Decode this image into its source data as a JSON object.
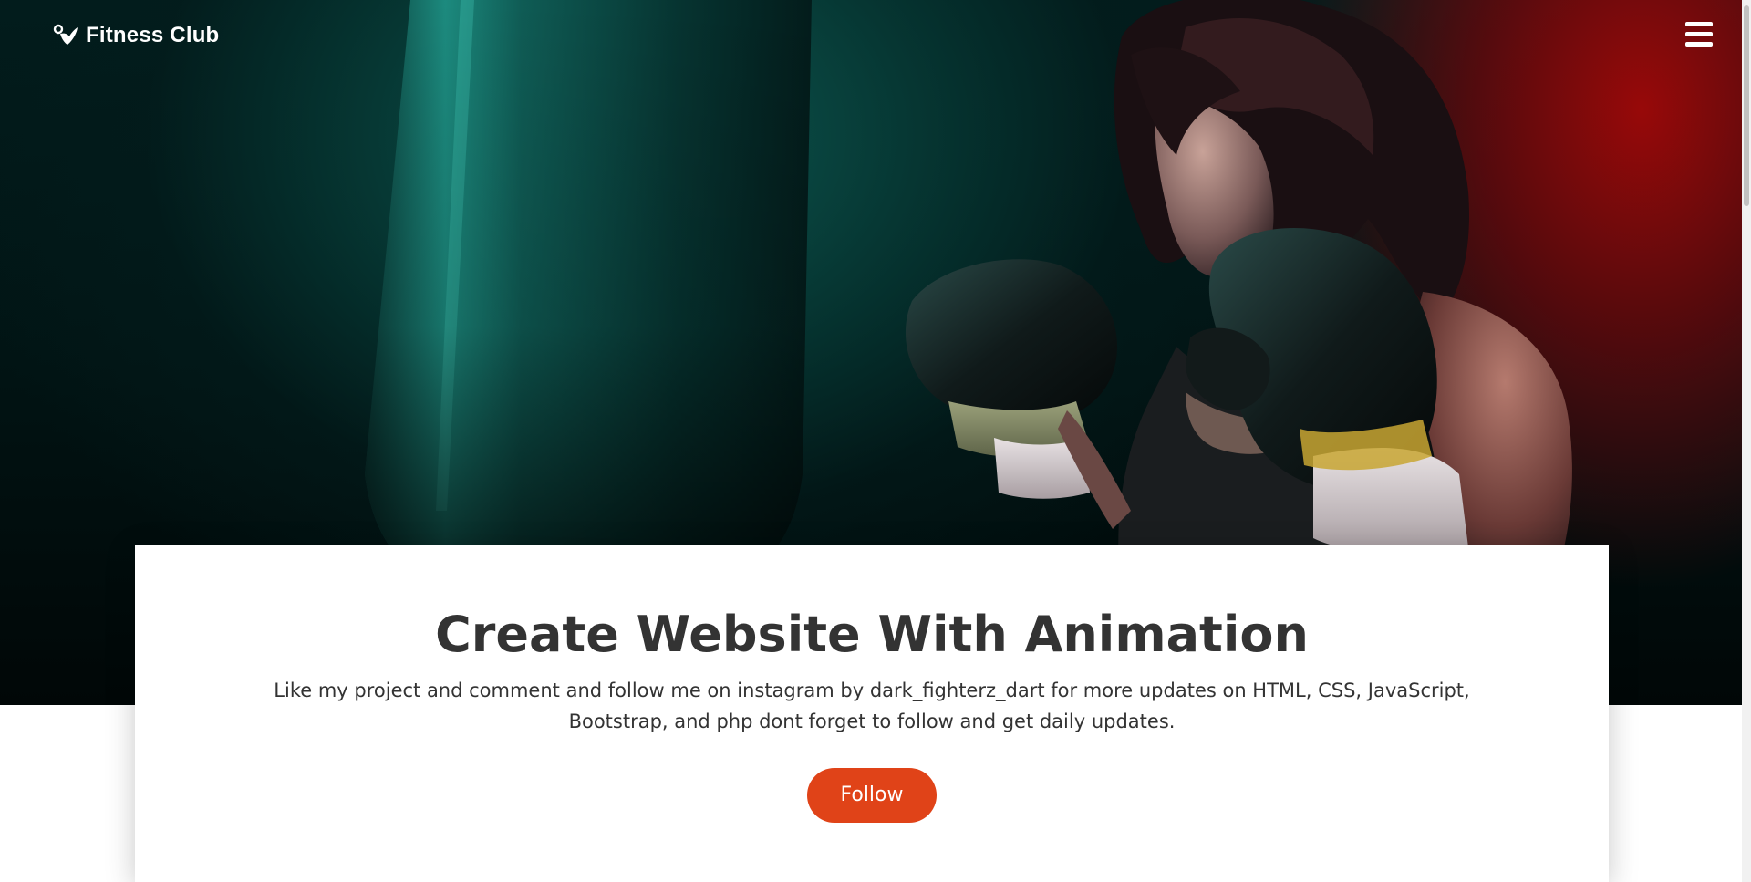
{
  "nav": {
    "brand": "Fitness Club",
    "brand_icon": "heart-leaf-logo-icon",
    "menu_icon": "hamburger-menu-icon"
  },
  "hero": {
    "image_subject": "boxer-with-punching-bag"
  },
  "card": {
    "title": "Create Website With Animation",
    "text": "Like my project and comment and follow me on instagram by dark_fighterz_dart for more updates on HTML, CSS, JavaScript, Bootstrap, and php dont forget to follow and get daily updates.",
    "button_label": "Follow"
  },
  "colors": {
    "accent": "#e04318",
    "title_text": "#333333",
    "hero_teal": "#0e5e56",
    "hero_red": "#a00808"
  }
}
